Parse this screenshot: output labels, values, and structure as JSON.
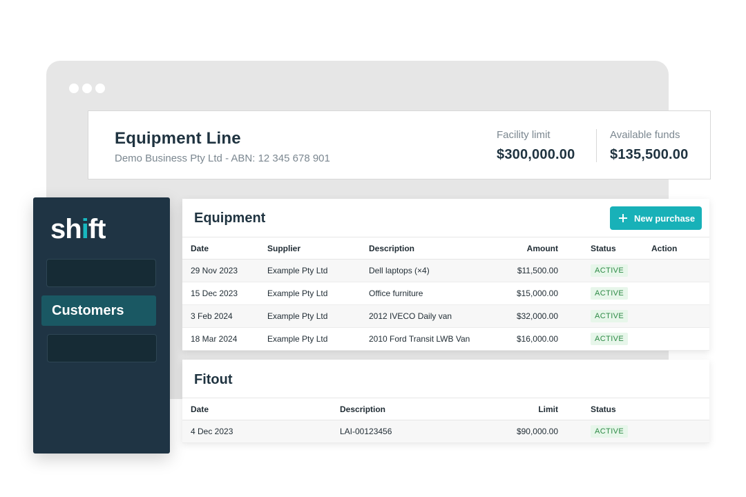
{
  "header": {
    "title": "Equipment Line",
    "subtitle": "Demo Business Pty Ltd - ABN: 12 345 678 901",
    "facility_limit_label": "Facility limit",
    "facility_limit_value": "$300,000.00",
    "available_funds_label": "Available funds",
    "available_funds_value": "$135,500.00"
  },
  "sidebar": {
    "logo": "shift",
    "active_item": "Customers"
  },
  "equipment": {
    "title": "Equipment",
    "new_purchase_label": "New purchase",
    "columns": [
      "Date",
      "Supplier",
      "Description",
      "Amount",
      "Status",
      "Action"
    ],
    "rows": [
      {
        "date": "29 Nov 2023",
        "supplier": "Example Pty Ltd",
        "description": "Dell laptops (×4)",
        "amount": "$11,500.00",
        "status": "ACTIVE"
      },
      {
        "date": "15 Dec 2023",
        "supplier": "Example Pty Ltd",
        "description": "Office furniture",
        "amount": "$15,000.00",
        "status": "ACTIVE"
      },
      {
        "date": "3 Feb 2024",
        "supplier": "Example Pty Ltd",
        "description": "2012 IVECO Daily van",
        "amount": "$32,000.00",
        "status": "ACTIVE"
      },
      {
        "date": "18 Mar 2024",
        "supplier": "Example Pty Ltd",
        "description": "2010 Ford Transit LWB Van",
        "amount": "$16,000.00",
        "status": "ACTIVE"
      }
    ]
  },
  "fitout": {
    "title": "Fitout",
    "columns": [
      "Date",
      "Description",
      "Limit",
      "Status"
    ],
    "rows": [
      {
        "date": "4 Dec 2023",
        "description": "LAI-00123456",
        "limit": "$90,000.00",
        "status": "ACTIVE"
      }
    ]
  },
  "colors": {
    "sidebar_bg": "#1f3444",
    "active_nav": "#1a5863",
    "accent": "#18b1b8",
    "status_bg": "#e7f6ea",
    "status_text": "#2d8a45"
  }
}
